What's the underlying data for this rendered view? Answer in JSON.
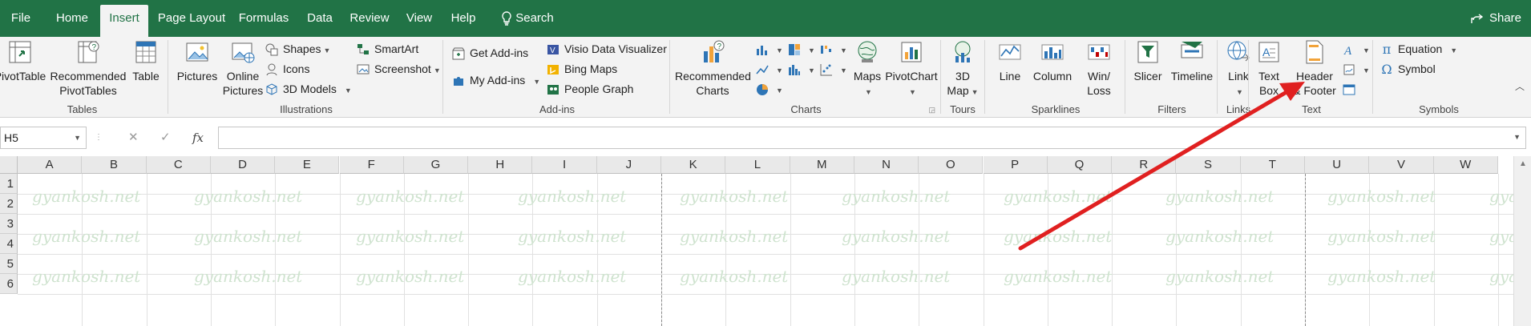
{
  "tabs": {
    "file": "File",
    "home": "Home",
    "insert": "Insert",
    "page_layout": "Page Layout",
    "formulas": "Formulas",
    "data": "Data",
    "review": "Review",
    "view": "View",
    "help": "Help",
    "search": "Search",
    "share": "Share"
  },
  "ribbon": {
    "tables": {
      "label": "Tables",
      "pivottable": "PivotTable",
      "recommended_pivot_1": "Recommended",
      "recommended_pivot_2": "PivotTables",
      "table": "Table"
    },
    "illustrations": {
      "label": "Illustrations",
      "pictures": "Pictures",
      "online_pictures_1": "Online",
      "online_pictures_2": "Pictures",
      "shapes": "Shapes",
      "icons": "Icons",
      "models_3d": "3D Models",
      "smartart": "SmartArt",
      "screenshot": "Screenshot"
    },
    "addins": {
      "label": "Add-ins",
      "get_addins": "Get Add-ins",
      "my_addins": "My Add-ins",
      "visio": "Visio Data Visualizer",
      "bing_maps": "Bing Maps",
      "people_graph": "People Graph"
    },
    "charts": {
      "label": "Charts",
      "recommended_1": "Recommended",
      "recommended_2": "Charts",
      "maps": "Maps",
      "pivotchart": "PivotChart"
    },
    "tours": {
      "label": "Tours",
      "map3d_1": "3D",
      "map3d_2": "Map"
    },
    "sparklines": {
      "label": "Sparklines",
      "line": "Line",
      "column": "Column",
      "winloss_1": "Win/",
      "winloss_2": "Loss"
    },
    "filters": {
      "label": "Filters",
      "slicer": "Slicer",
      "timeline": "Timeline"
    },
    "links": {
      "label": "Links",
      "link": "Link"
    },
    "text": {
      "label": "Text",
      "textbox_1": "Text",
      "textbox_2": "Box",
      "header_1": "Header",
      "header_2": "& Footer"
    },
    "symbols": {
      "label": "Symbols",
      "equation": "Equation",
      "symbol": "Symbol"
    }
  },
  "formula_bar": {
    "name_box": "H5",
    "cancel": "✕",
    "enter": "✓",
    "fx": "fx",
    "formula": ""
  },
  "grid": {
    "columns": [
      "A",
      "B",
      "C",
      "D",
      "E",
      "F",
      "G",
      "H",
      "I",
      "J",
      "K",
      "L",
      "M",
      "N",
      "O",
      "P",
      "Q",
      "R",
      "S",
      "T",
      "U",
      "V",
      "W"
    ],
    "rows": [
      "1",
      "2",
      "3",
      "4",
      "5",
      "6"
    ],
    "watermark": "gyankosh.net"
  },
  "colors": {
    "excel_green": "#217346",
    "annotation_arrow": "#e02020"
  }
}
